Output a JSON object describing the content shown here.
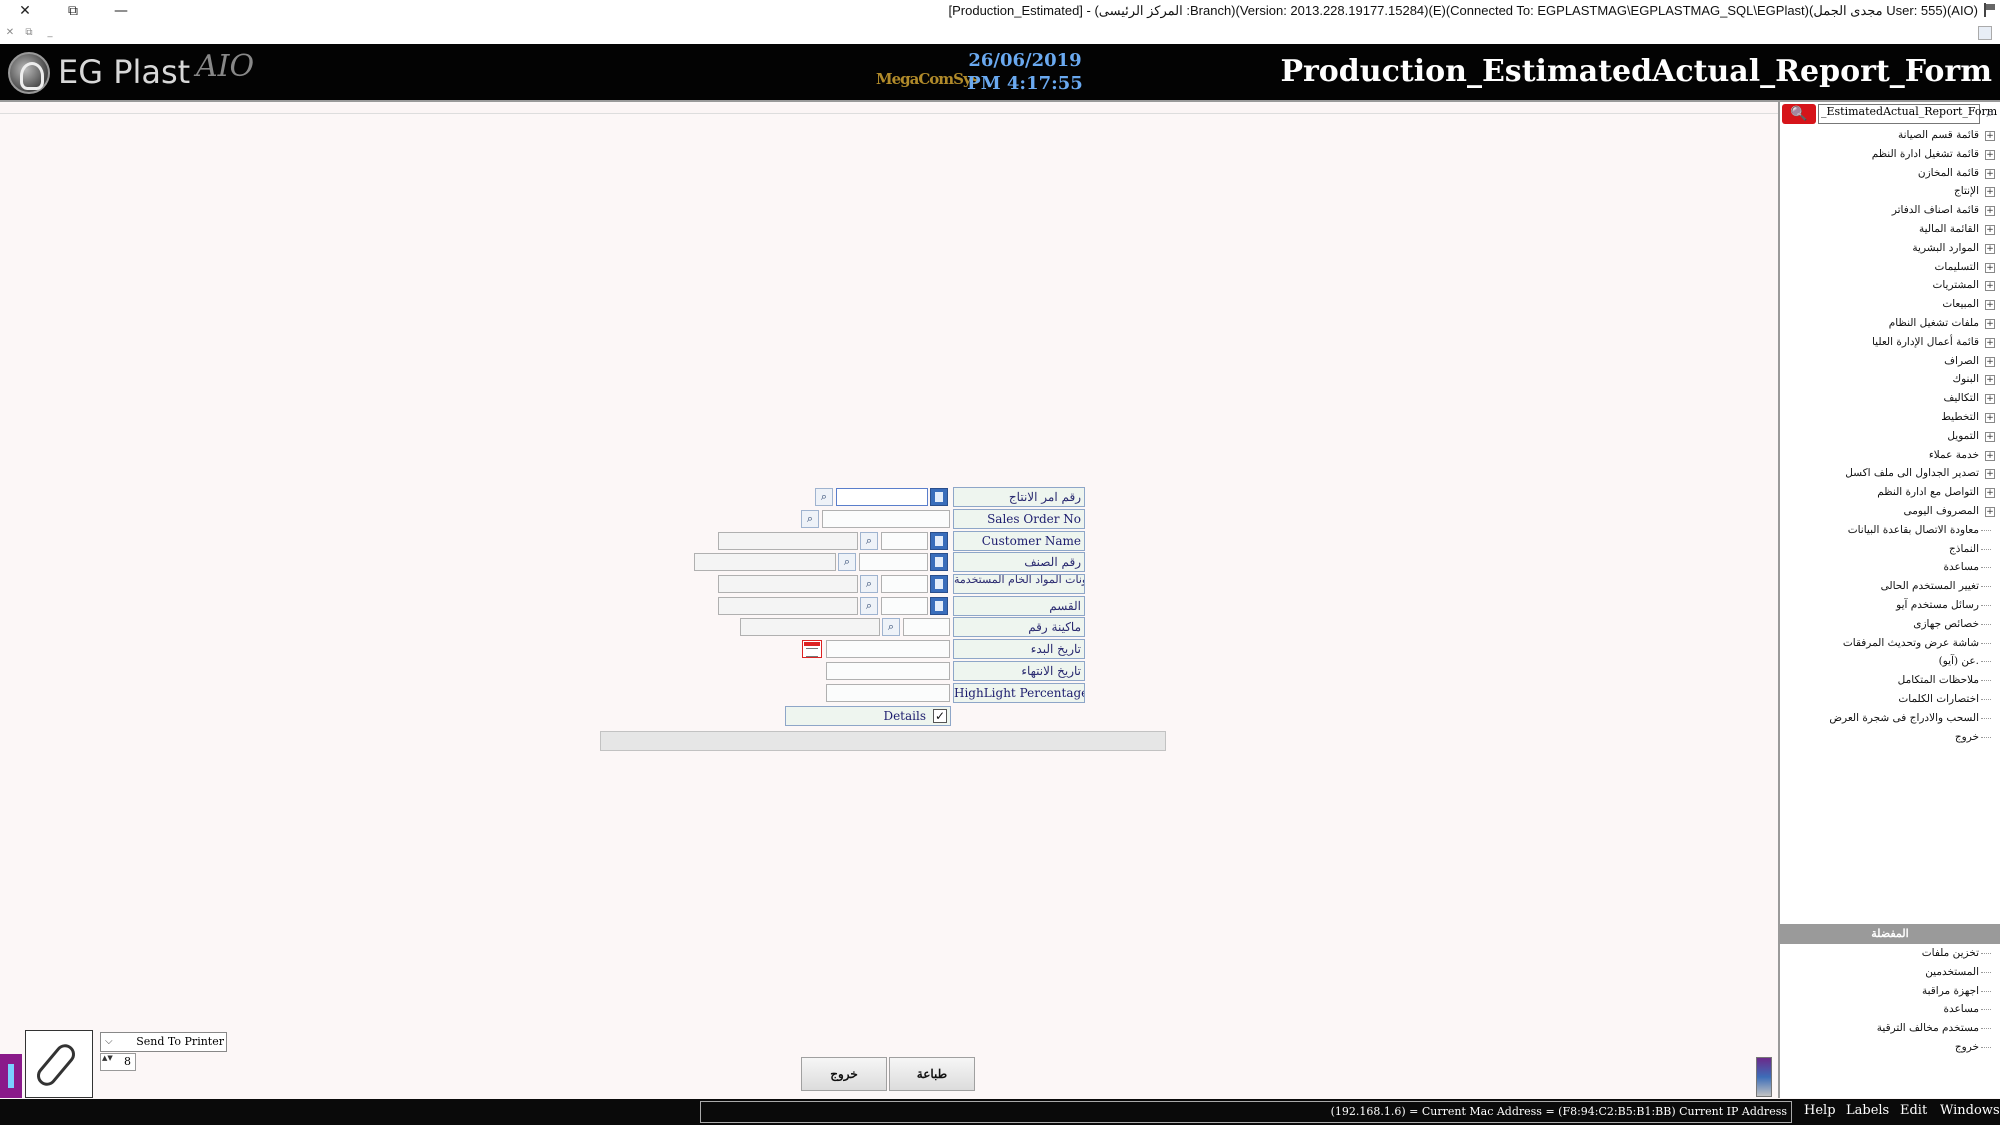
{
  "window": {
    "title": "[Production_Estimated] - (المركز الرئيسى :Branch)(Version: 2013.228.19177.15284)(E)(Connected To: EGPLASTMAG\\EGPLASTMAG_SQL\\EGPlast)(مجدى الجمل User: 555)(AIO)",
    "controls": {
      "close": "✕",
      "restore": "⧉",
      "minimize": "—"
    },
    "sub_controls": {
      "close": "✕",
      "restore": "⧉",
      "minimize": "_"
    }
  },
  "header": {
    "logo_text": "EG Plast",
    "logo_suffix": "AIO",
    "mid_logo": "MegaComSys",
    "date": "26/06/2019",
    "time": "PM 4:17:55",
    "form_title": "Production_EstimatedActual_Report_Form"
  },
  "sidebar": {
    "search_value": "_EstimatedActual_Report_Form",
    "search_red_icon": "🔍",
    "search_mag_icon": "⌕",
    "tree": [
      {
        "label": "قائمة قسم الصيانة",
        "expandable": true
      },
      {
        "label": "قائمة تشغيل ادارة النظم",
        "expandable": true
      },
      {
        "label": "قائمة المخازن",
        "expandable": true
      },
      {
        "label": "الإنتاج",
        "expandable": true
      },
      {
        "label": "قائمة اصناف الدفاتر",
        "expandable": true
      },
      {
        "label": "القائمة المالية",
        "expandable": true
      },
      {
        "label": "الموارد البشرية",
        "expandable": true
      },
      {
        "label": "التسليمات",
        "expandable": true
      },
      {
        "label": "المشتريات",
        "expandable": true
      },
      {
        "label": "المبيعات",
        "expandable": true
      },
      {
        "label": "ملفات تشغيل النظام",
        "expandable": true
      },
      {
        "label": "قائمة أعمال الإدارة العليا",
        "expandable": true
      },
      {
        "label": "الصراف",
        "expandable": true
      },
      {
        "label": "البنوك",
        "expandable": true
      },
      {
        "label": "التكاليف",
        "expandable": true
      },
      {
        "label": "التخطيط",
        "expandable": true
      },
      {
        "label": "التمويل",
        "expandable": true
      },
      {
        "label": "خدمة عملاء",
        "expandable": true
      },
      {
        "label": "تصدير الجداول الى ملف اكسل",
        "expandable": true
      },
      {
        "label": "التواصل مع ادارة النظم",
        "expandable": true
      },
      {
        "label": "المصروف اليومى",
        "expandable": true
      },
      {
        "label": "معاودة الاتصال بقاعدة البيانات",
        "expandable": false
      },
      {
        "label": "النماذج",
        "expandable": false
      },
      {
        "label": "مساعدة",
        "expandable": false
      },
      {
        "label": "تغيير المستخدم الحالى",
        "expandable": false
      },
      {
        "label": "رسائل مستخدم آيو",
        "expandable": false
      },
      {
        "label": "خصائص جهازى",
        "expandable": false
      },
      {
        "label": "شاشة عرض وتحديث المرفقات",
        "expandable": false
      },
      {
        "label": "عن (آيو).",
        "expandable": false
      },
      {
        "label": "ملاحظات المتكامل",
        "expandable": false
      },
      {
        "label": "اختصارات الكلمات",
        "expandable": false
      },
      {
        "label": "السحب والادراج فى شجرة العرض",
        "expandable": false
      },
      {
        "label": "خروج",
        "expandable": false
      }
    ],
    "favorites_header": "المفضلة",
    "favorites": [
      "تخزين ملفات",
      "المستخدمين",
      "اجهزة مراقبة",
      "مساعدة",
      "مستخدم مخالف الترقية",
      "خروج"
    ]
  },
  "form": {
    "labels": {
      "production_order": "رقم امر الانتاج",
      "sales_order": "Sales Order No",
      "customer_name": "Customer Name",
      "item_no": "رقم الصنف",
      "materials": "رقم مكونات المواد الخام المستخدمة",
      "section": "القسم",
      "machine": "ماكينة رقم",
      "start_date": "تاريخ البدء",
      "end_date": "تاريخ الانتهاء",
      "highlight": "HighLight Percentage",
      "details": "Details"
    },
    "details_checked": "✓",
    "search_icon": "⌕",
    "values": {
      "production_order": "",
      "sales_order": "",
      "customer_name": "",
      "item_no": "",
      "materials": "",
      "section": "",
      "machine": "",
      "start_date": "",
      "end_date": "",
      "highlight": ""
    }
  },
  "buttons": {
    "print": "طباعة",
    "exit": "خروج"
  },
  "printer": {
    "mode": "Send To Printer",
    "copies": "8",
    "dropdown_icon": "⌵",
    "spin_icon": "▲▼"
  },
  "statusbar": {
    "info": "(192.168.1.6) = Current Mac Address = (F8:94:C2:B5:B1:BB) Current IP Address",
    "menu": [
      "Help",
      "Labels",
      "Edit",
      "Windows"
    ]
  }
}
